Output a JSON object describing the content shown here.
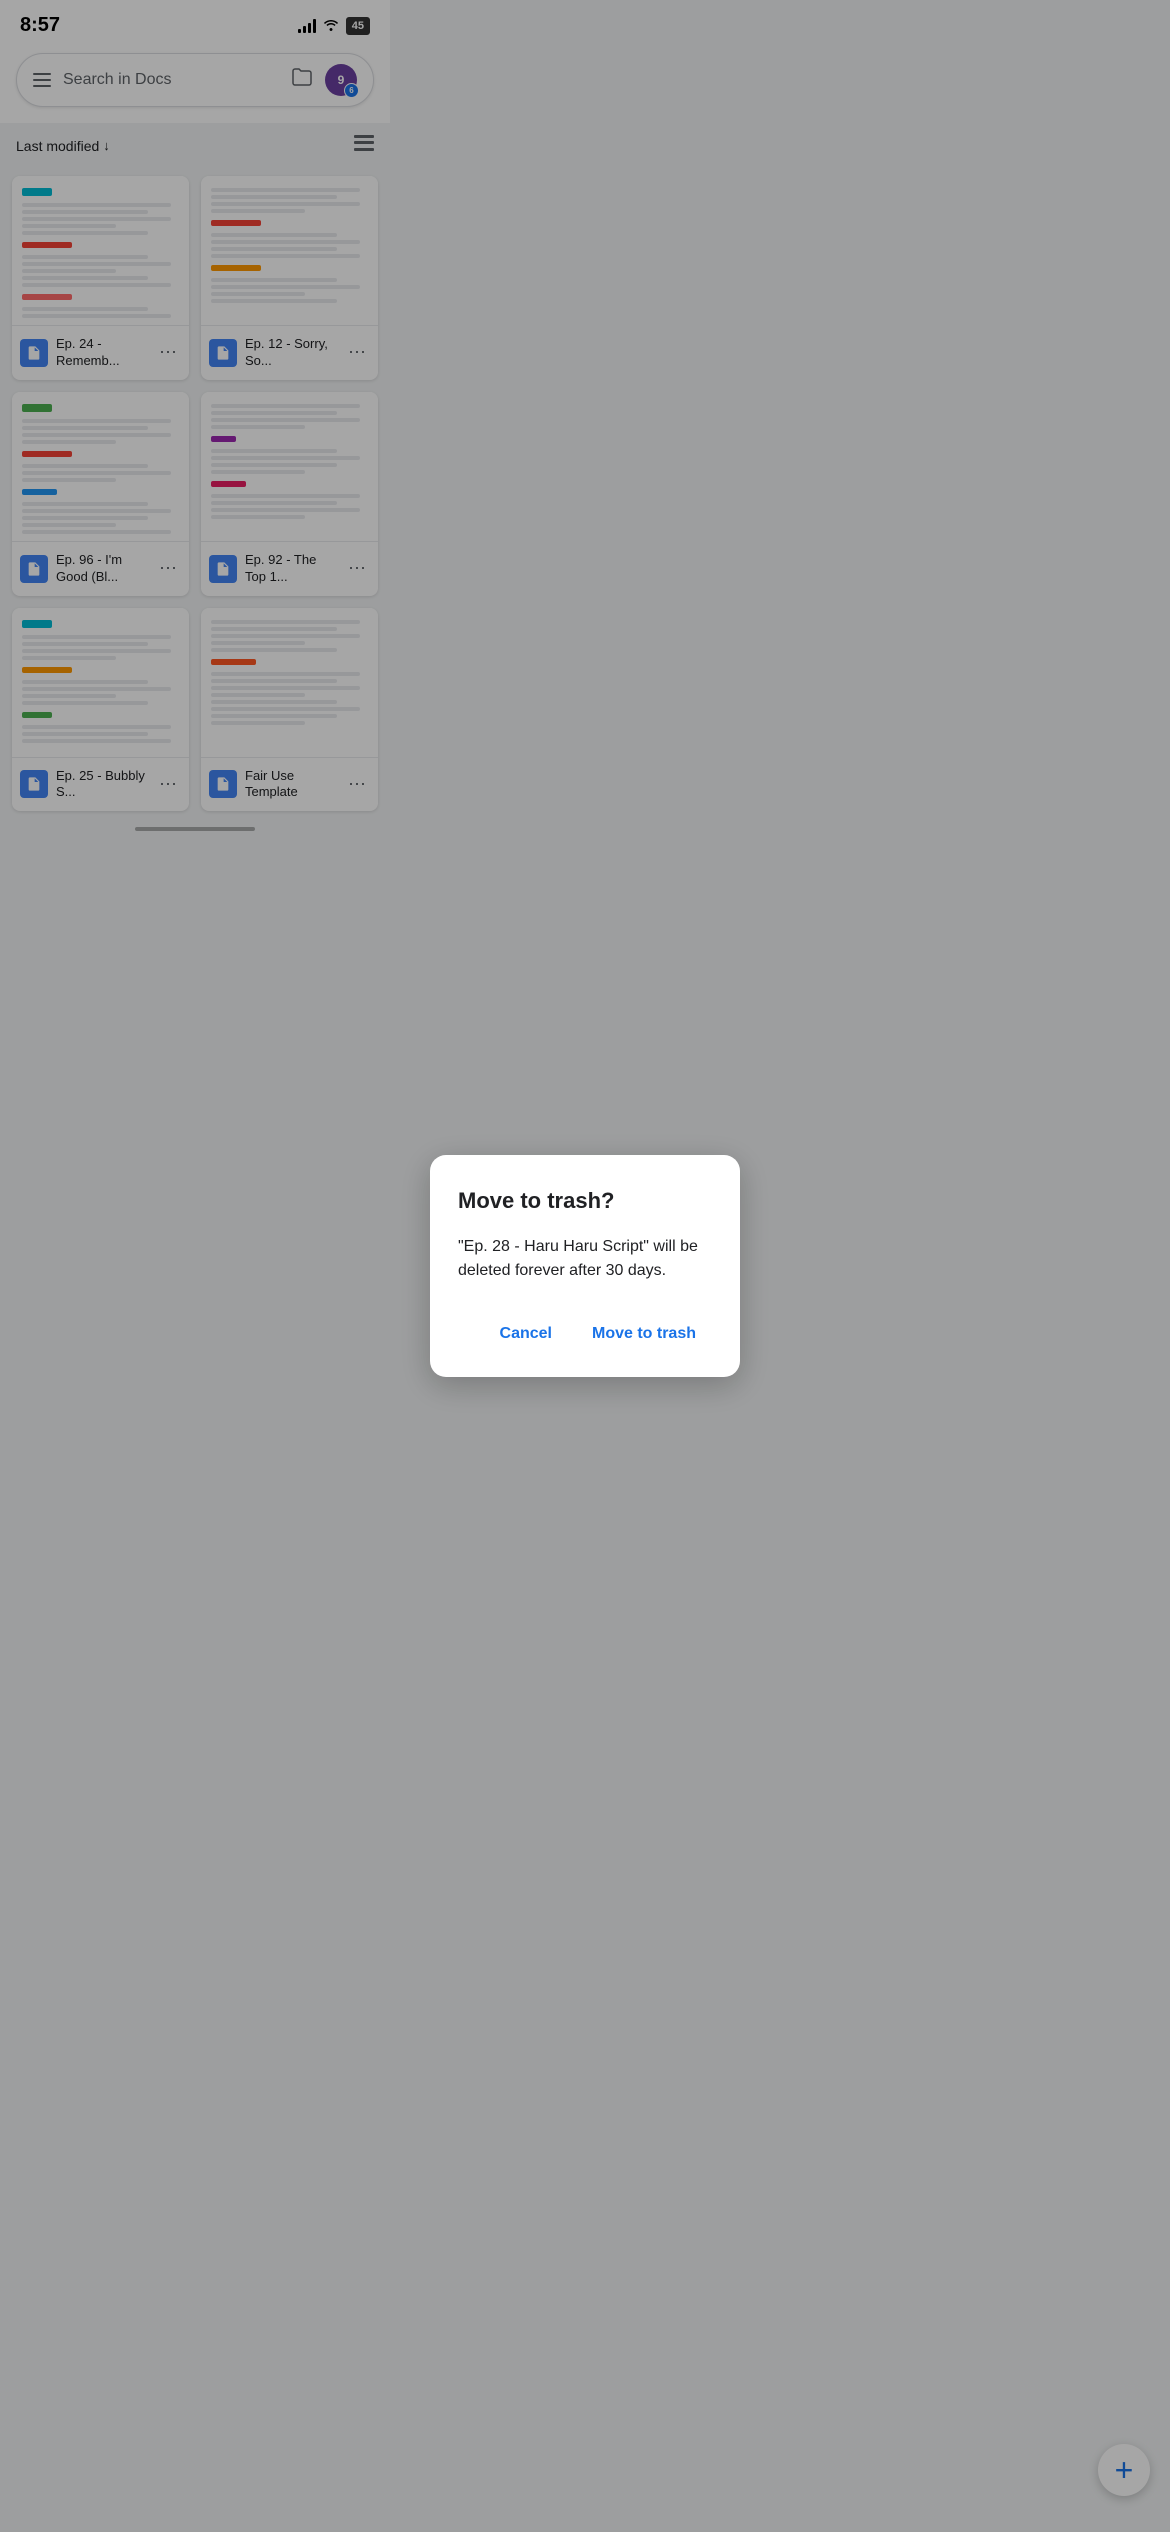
{
  "statusBar": {
    "time": "8:57",
    "battery": "45"
  },
  "header": {
    "searchPlaceholder": "Search in Docs",
    "avatarInitial": "9"
  },
  "sortBar": {
    "label": "Last modified",
    "arrow": "↓"
  },
  "documents": [
    {
      "id": "doc1",
      "name": "Ep. 24 - Rememb...",
      "previewColor": "teal"
    },
    {
      "id": "doc2",
      "name": "Ep. 12 - Sorry, So...",
      "previewColor": "none"
    },
    {
      "id": "doc3",
      "name": "Ep. 96 - I'm Good (Bl...",
      "previewColor": "red"
    },
    {
      "id": "doc4",
      "name": "Ep. 92 - The Top 1...",
      "previewColor": "none"
    },
    {
      "id": "doc5",
      "name": "Ep. 25 - Bubbly S...",
      "previewColor": "orange"
    },
    {
      "id": "doc6",
      "name": "Fair Use Template",
      "previewColor": "none"
    }
  ],
  "dialog": {
    "title": "Move to trash?",
    "body": "\"Ep. 28 - Haru Haru Script\" will be deleted forever after 30 days.",
    "cancelLabel": "Cancel",
    "confirmLabel": "Move to trash"
  },
  "fab": {
    "icon": "+"
  }
}
